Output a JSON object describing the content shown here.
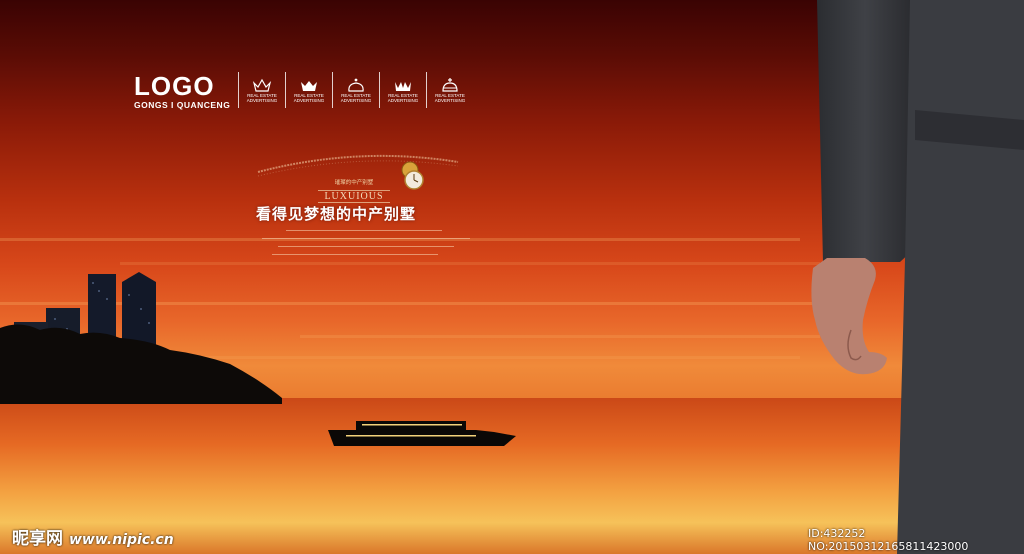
{
  "brand": {
    "logo_text": "LOGO",
    "logo_subtitle": "GONGS I QUANCENG"
  },
  "crowns": [
    {
      "icon": "crown-icon",
      "label": "REAL ESTATE ADVERTISING"
    },
    {
      "icon": "crown-icon",
      "label": "REAL ESTATE ADVERTISING"
    },
    {
      "icon": "crown-icon",
      "label": "REAL ESTATE ADVERTISING"
    },
    {
      "icon": "crown-icon",
      "label": "REAL ESTATE ADVERTISING"
    },
    {
      "icon": "crown-icon",
      "label": "REAL ESTATE ADVERTISING"
    }
  ],
  "headline": {
    "small_cn": "璀璨的中产别墅",
    "luxurious": "LUXUIOUS",
    "title_cn": "看得见梦想的中产别墅"
  },
  "watermark": {
    "site_cn": "昵享网",
    "site_url": "www.nipic.cn",
    "id_line": "ID:432252 NO:20150312165811423000"
  },
  "colors": {
    "sky_top": "#3a0303",
    "sky_mid": "#d8481a",
    "horizon": "#f7c058"
  }
}
